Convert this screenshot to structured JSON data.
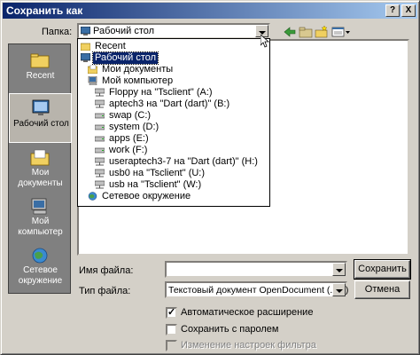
{
  "window": {
    "title": "Сохранить как",
    "help_label": "?",
    "close_label": "X"
  },
  "folder": {
    "label": "Папка:",
    "current": "Рабочий стол"
  },
  "toolbar": {
    "icons": [
      "back-arrow-icon",
      "up-folder-icon",
      "new-folder-icon",
      "view-menu-icon"
    ]
  },
  "places": [
    {
      "label": "Recent",
      "icon": "recent-folder-icon"
    },
    {
      "label": "Рабочий стол",
      "icon": "desktop-icon"
    },
    {
      "label": "Мои документы",
      "icon": "my-documents-icon"
    },
    {
      "label": "Мой компьютер",
      "icon": "my-computer-icon"
    },
    {
      "label": "Сетевое окружение",
      "icon": "network-icon"
    }
  ],
  "dropdown": {
    "items": [
      {
        "label": "Recent",
        "icon": "folder-icon"
      },
      {
        "label": "Рабочий стол",
        "icon": "desktop-icon"
      },
      {
        "label": "Мои документы",
        "icon": "folder-icon"
      },
      {
        "label": "Мой компьютер",
        "icon": "computer-icon"
      },
      {
        "label": "Floppy на \"Tsclient\" (A:)",
        "icon": "network-drive-icon"
      },
      {
        "label": "aptech3 на \"Dart (dart)\" (B:)",
        "icon": "network-drive-icon"
      },
      {
        "label": "swap (C:)",
        "icon": "drive-icon"
      },
      {
        "label": "system (D:)",
        "icon": "drive-icon"
      },
      {
        "label": "apps (E:)",
        "icon": "drive-icon"
      },
      {
        "label": "work (F:)",
        "icon": "drive-icon"
      },
      {
        "label": "useraptech3-7 на \"Dart (dart)\" (H:)",
        "icon": "network-drive-icon"
      },
      {
        "label": "usb0 на \"Tsclient\" (U:)",
        "icon": "network-drive-icon"
      },
      {
        "label": "usb на \"Tsclient\" (W:)",
        "icon": "network-drive-icon"
      },
      {
        "label": "Сетевое окружение",
        "icon": "network-icon"
      }
    ]
  },
  "filename": {
    "label": "Имя файла:",
    "value": ""
  },
  "filetype": {
    "label": "Тип файла:",
    "value": "Текстовый документ OpenDocument (.odt)"
  },
  "buttons": {
    "save": "Сохранить",
    "cancel": "Отмена"
  },
  "options": {
    "auto_ext": {
      "label": "Автоматическое расширение",
      "checked": true
    },
    "password": {
      "label": "Сохранить с паролем",
      "checked": false
    },
    "filter": {
      "label": "Изменение настроек фильтра",
      "checked": false,
      "disabled": true
    }
  }
}
